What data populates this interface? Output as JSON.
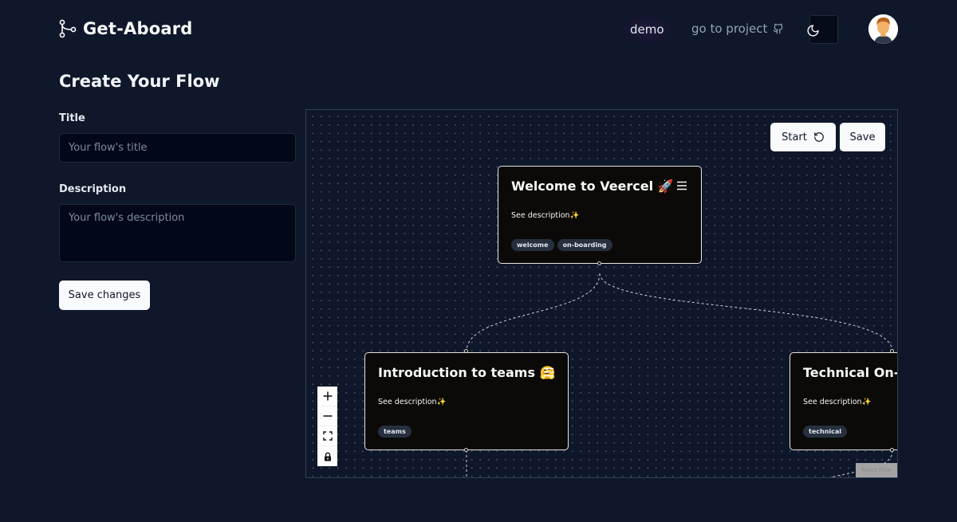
{
  "header": {
    "brand": "Get-Aboard",
    "nav": {
      "demo": "demo",
      "project": "go to project"
    }
  },
  "form": {
    "heading": "Create Your Flow",
    "title_label": "Title",
    "title_placeholder": "Your flow's title",
    "description_label": "Description",
    "description_placeholder": "Your flow's description",
    "save_label": "Save changes"
  },
  "canvas": {
    "start_label": "Start",
    "save_label": "Save",
    "nodes": [
      {
        "title": "Welcome to Veercel 🚀",
        "description": "See description✨",
        "tags": [
          "welcome",
          "on-boarding"
        ]
      },
      {
        "title": "Introduction to teams 🤗",
        "description": "See description✨",
        "tags": [
          "teams"
        ]
      },
      {
        "title": "Technical On-Boarding",
        "description": "See description✨",
        "tags": [
          "technical"
        ]
      }
    ],
    "attribution": "React Flow"
  },
  "icons": {
    "brand": "git-branch-icon",
    "github": "github-icon",
    "theme": "moon-icon",
    "restart": "rotate-ccw-icon",
    "menu": "hamburger-menu-icon",
    "zoom_in": "plus-icon",
    "zoom_out": "minus-icon",
    "fit_view": "fit-view-icon",
    "lock": "lock-icon"
  },
  "colors": {
    "background": "#0f172a",
    "node_background": "#0c0a09",
    "button_light": "#f8fafc"
  }
}
